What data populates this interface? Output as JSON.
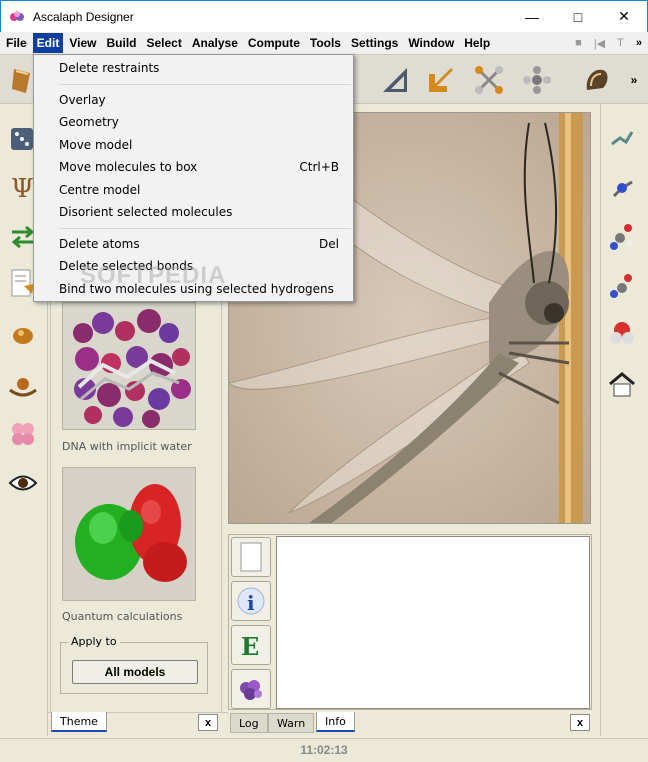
{
  "window": {
    "title": "Ascalaph Designer"
  },
  "menubar": {
    "items": [
      "File",
      "Edit",
      "View",
      "Build",
      "Select",
      "Analyse",
      "Compute",
      "Tools",
      "Settings",
      "Window",
      "Help"
    ],
    "right_glyphs": [
      "■",
      "|◀",
      "T",
      "»"
    ]
  },
  "edit_menu": {
    "group1": [
      {
        "label": "Delete restraints",
        "shortcut": ""
      }
    ],
    "group2": [
      {
        "label": "Overlay",
        "shortcut": ""
      },
      {
        "label": "Geometry",
        "shortcut": ""
      },
      {
        "label": "Move model",
        "shortcut": ""
      },
      {
        "label": "Move molecules to box",
        "shortcut": "Ctrl+B"
      },
      {
        "label": "Centre model",
        "shortcut": ""
      },
      {
        "label": "Disorient selected molecules",
        "shortcut": ""
      }
    ],
    "group3": [
      {
        "label": "Delete atoms",
        "shortcut": "Del"
      },
      {
        "label": "Delete selected bonds",
        "shortcut": ""
      },
      {
        "label": "Bind two molecules using selected hydrogens",
        "shortcut": ""
      }
    ]
  },
  "theme_panel": {
    "caption1": "DNA with implicit water",
    "caption2": "Quantum calculations",
    "apply_legend": "Apply to",
    "apply_button": "All models"
  },
  "tabs_left": {
    "theme": "Theme",
    "close": "x"
  },
  "tabs_bottom": {
    "log": "Log",
    "warn": "Warn",
    "info": "Info",
    "close": "x"
  },
  "console": {
    "text": ""
  },
  "status": {
    "time": "11:02:13"
  },
  "watermark": "SOFTPEDIA"
}
